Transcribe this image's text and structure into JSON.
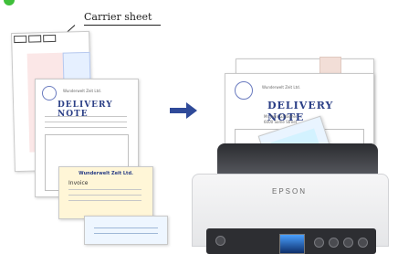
{
  "caption": {
    "carrier_sheet": "Carrier sheet"
  },
  "left_stack": {
    "delivery_note_title": "DELIVERY NOTE",
    "company_header": "Wunderwelt Zeit Ltd.",
    "invoice_header": "Wunderwelt Zeit Ltd.",
    "invoice_label": "Invoice",
    "carrier_tabs": [
      "▭",
      "▭",
      "▭"
    ]
  },
  "right_scanned_doc": {
    "title": "DELIVERY NOTE",
    "company": "Wunderwelt Zeit Ltd.",
    "customer_name": "Mr. John Gallagher",
    "street": "6000 Some Street"
  },
  "scanner": {
    "brand": "EPSON"
  },
  "colors": {
    "arrow": "#2f4a99",
    "delivery_blue": "#3d6fb6",
    "accent_green": "#3fbf3a"
  }
}
